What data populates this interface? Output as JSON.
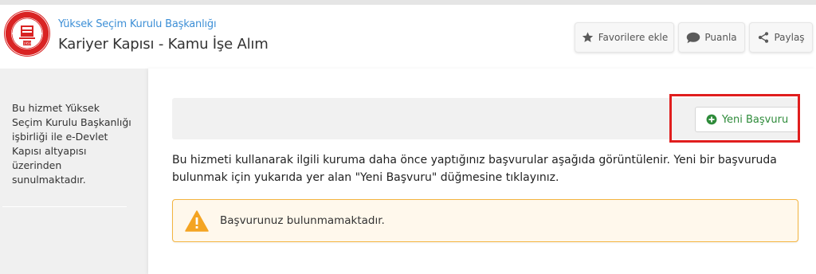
{
  "header": {
    "org_name": "Yüksek Seçim Kurulu Başkanlığı",
    "title": "Kariyer Kapısı - Kamu İşe Alım",
    "buttons": {
      "favorite": "Favorilere ekle",
      "rate": "Puanla",
      "share": "Paylaş"
    },
    "icons": {
      "favorite": "star-icon",
      "rate": "speech-bubble-icon",
      "share": "share-icon"
    }
  },
  "sidebar": {
    "description": "Bu hizmet Yüksek Seçim Kurulu Başkanlığı işbirliği ile e-Devlet Kapısı altyapısı üzerinden sunulmaktadır."
  },
  "main": {
    "new_application_label": "Yeni Başvuru",
    "info_text": "Bu hizmeti kullanarak ilgili kuruma daha önce yaptığınız başvurular aşağıda görüntülenir. Yeni bir başvuruda bulunmak için yukarıda yer alan \"Yeni Başvuru\" düğmesine tıklayınız.",
    "alert_text": "Başvurunuz bulunmamaktadır."
  },
  "colors": {
    "link": "#3d8fd6",
    "success": "#2e8b3a",
    "warning": "#f4a422",
    "highlight": "#e01e1e"
  }
}
